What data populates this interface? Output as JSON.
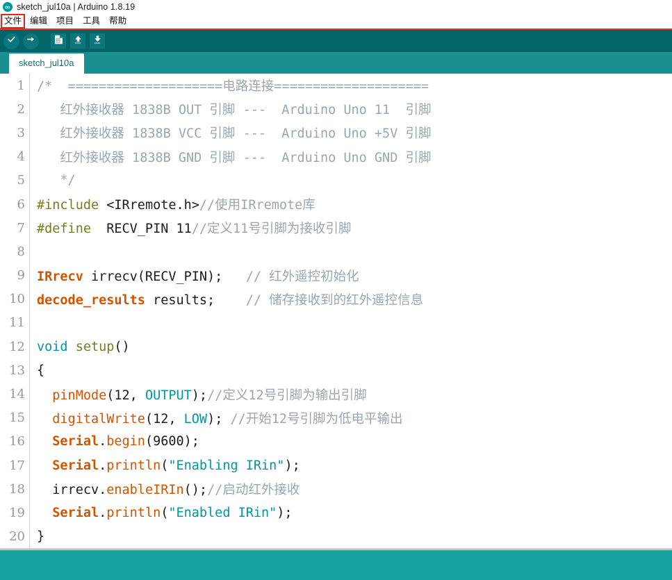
{
  "window": {
    "title": "sketch_jul10a | Arduino 1.8.19",
    "logo_icon": "arduino-infinity-icon"
  },
  "menubar": {
    "items": [
      {
        "label": "文件",
        "highlighted": true
      },
      {
        "label": "编辑",
        "highlighted": false
      },
      {
        "label": "项目",
        "highlighted": false
      },
      {
        "label": "工具",
        "highlighted": false
      },
      {
        "label": "帮助",
        "highlighted": false
      }
    ],
    "highlight_color": "#e8231a"
  },
  "toolbar": {
    "background": "#006468",
    "button_background": "#0b777c",
    "buttons": [
      {
        "name": "verify-button",
        "icon": "checkmark-icon",
        "shape": "round"
      },
      {
        "name": "upload-button",
        "icon": "arrow-right-icon",
        "shape": "round"
      },
      {
        "name": "new-button",
        "icon": "new-document-icon",
        "shape": "square"
      },
      {
        "name": "open-button",
        "icon": "arrow-up-icon",
        "shape": "square"
      },
      {
        "name": "save-button",
        "icon": "arrow-down-icon",
        "shape": "square"
      }
    ]
  },
  "tabbar": {
    "background": "#1a8f92",
    "active_tab": "sketch_jul10a"
  },
  "console": {
    "background": "#17a2a2",
    "text": ""
  },
  "editor": {
    "font": "monospace",
    "colors": {
      "comment": "#9aa7b0",
      "preprocessor": "#7a7a20",
      "keyword": "#00979c",
      "function": "#d35400",
      "type": "#d35400",
      "literal": "#00979c",
      "string": "#00979c",
      "plain": "#1b1b1b",
      "gutter": "#999999"
    },
    "lines": [
      {
        "n": 1,
        "tokens": [
          {
            "t": "comment",
            "v": "/*  ====================电路连接===================="
          }
        ]
      },
      {
        "n": 2,
        "tokens": [
          {
            "t": "comment",
            "v": "   红外接收器 1838B OUT 引脚 ---  Arduino Uno 11  引脚"
          }
        ]
      },
      {
        "n": 3,
        "tokens": [
          {
            "t": "comment",
            "v": "   红外接收器 1838B VCC 引脚 ---  Arduino Uno +5V 引脚"
          }
        ]
      },
      {
        "n": 4,
        "tokens": [
          {
            "t": "comment",
            "v": "   红外接收器 1838B GND 引脚 ---  Arduino Uno GND 引脚"
          }
        ]
      },
      {
        "n": 5,
        "tokens": [
          {
            "t": "comment",
            "v": "   */"
          }
        ]
      },
      {
        "n": 6,
        "tokens": [
          {
            "t": "preprocessor",
            "v": "#include"
          },
          {
            "t": "plain",
            "v": " "
          },
          {
            "t": "plain",
            "v": "<IRremote.h>"
          },
          {
            "t": "comment",
            "v": "//使用IRremote库"
          }
        ]
      },
      {
        "n": 7,
        "tokens": [
          {
            "t": "preprocessor",
            "v": "#define"
          },
          {
            "t": "plain",
            "v": "  RECV_PIN 11"
          },
          {
            "t": "comment",
            "v": "//定义11号引脚为接收引脚"
          }
        ]
      },
      {
        "n": 8,
        "tokens": []
      },
      {
        "n": 9,
        "tokens": [
          {
            "t": "type",
            "v": "IRrecv"
          },
          {
            "t": "plain",
            "v": " irrecv(RECV_PIN);   "
          },
          {
            "t": "comment",
            "v": "// 红外遥控初始化"
          }
        ]
      },
      {
        "n": 10,
        "tokens": [
          {
            "t": "type",
            "v": "decode_results"
          },
          {
            "t": "plain",
            "v": " results;    "
          },
          {
            "t": "comment",
            "v": "// 储存接收到的红外遥控信息"
          }
        ]
      },
      {
        "n": 11,
        "tokens": []
      },
      {
        "n": 12,
        "tokens": [
          {
            "t": "keyword",
            "v": "void"
          },
          {
            "t": "plain",
            "v": " "
          },
          {
            "t": "preprocessor",
            "v": "setup"
          },
          {
            "t": "plain",
            "v": "()"
          }
        ]
      },
      {
        "n": 13,
        "tokens": [
          {
            "t": "plain",
            "v": "{"
          }
        ]
      },
      {
        "n": 14,
        "tokens": [
          {
            "t": "plain",
            "v": "  "
          },
          {
            "t": "function",
            "v": "pinMode"
          },
          {
            "t": "plain",
            "v": "(12, "
          },
          {
            "t": "literal",
            "v": "OUTPUT"
          },
          {
            "t": "plain",
            "v": ");"
          },
          {
            "t": "comment",
            "v": "//定义12号引脚为输出引脚"
          }
        ]
      },
      {
        "n": 15,
        "tokens": [
          {
            "t": "plain",
            "v": "  "
          },
          {
            "t": "function",
            "v": "digitalWrite"
          },
          {
            "t": "plain",
            "v": "(12, "
          },
          {
            "t": "literal",
            "v": "LOW"
          },
          {
            "t": "plain",
            "v": "); "
          },
          {
            "t": "comment",
            "v": "//开始12号引脚为低电平输出"
          }
        ]
      },
      {
        "n": 16,
        "tokens": [
          {
            "t": "plain",
            "v": "  "
          },
          {
            "t": "type",
            "v": "Serial"
          },
          {
            "t": "plain",
            "v": "."
          },
          {
            "t": "function",
            "v": "begin"
          },
          {
            "t": "plain",
            "v": "(9600);"
          }
        ]
      },
      {
        "n": 17,
        "tokens": [
          {
            "t": "plain",
            "v": "  "
          },
          {
            "t": "type",
            "v": "Serial"
          },
          {
            "t": "plain",
            "v": "."
          },
          {
            "t": "function",
            "v": "println"
          },
          {
            "t": "plain",
            "v": "("
          },
          {
            "t": "string",
            "v": "\"Enabling IRin\""
          },
          {
            "t": "plain",
            "v": ");"
          }
        ]
      },
      {
        "n": 18,
        "tokens": [
          {
            "t": "plain",
            "v": "  irrecv."
          },
          {
            "t": "function",
            "v": "enableIRIn"
          },
          {
            "t": "plain",
            "v": "();"
          },
          {
            "t": "comment",
            "v": "//启动红外接收"
          }
        ]
      },
      {
        "n": 19,
        "tokens": [
          {
            "t": "plain",
            "v": "  "
          },
          {
            "t": "type",
            "v": "Serial"
          },
          {
            "t": "plain",
            "v": "."
          },
          {
            "t": "function",
            "v": "println"
          },
          {
            "t": "plain",
            "v": "("
          },
          {
            "t": "string",
            "v": "\"Enabled IRin\""
          },
          {
            "t": "plain",
            "v": ");"
          }
        ]
      },
      {
        "n": 20,
        "tokens": [
          {
            "t": "plain",
            "v": "}"
          }
        ]
      }
    ]
  }
}
